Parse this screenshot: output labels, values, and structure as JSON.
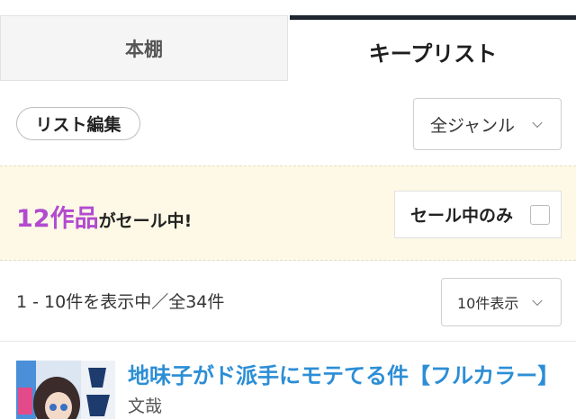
{
  "tabs": {
    "shelf_label": "本棚",
    "keep_label": "キープリスト"
  },
  "toolbar": {
    "edit_label": "リスト編集",
    "genre_value": "全ジャンル"
  },
  "sale": {
    "count": "12作品",
    "suffix": "がセール中!",
    "filter_label": "セール中のみ",
    "filter_checked": false
  },
  "pager": {
    "range_text": "1 - 10件を表示中／全34件",
    "per_page_value": "10件表示"
  },
  "items": [
    {
      "title": "地味子がド派手にモテてる件【フルカラー】",
      "author": "文哉"
    }
  ],
  "colors": {
    "accent_purple": "#b24bd0",
    "link_blue": "#2c8ed6",
    "banner_bg": "#fdf9e6",
    "tab_active_border": "#1f2630"
  }
}
